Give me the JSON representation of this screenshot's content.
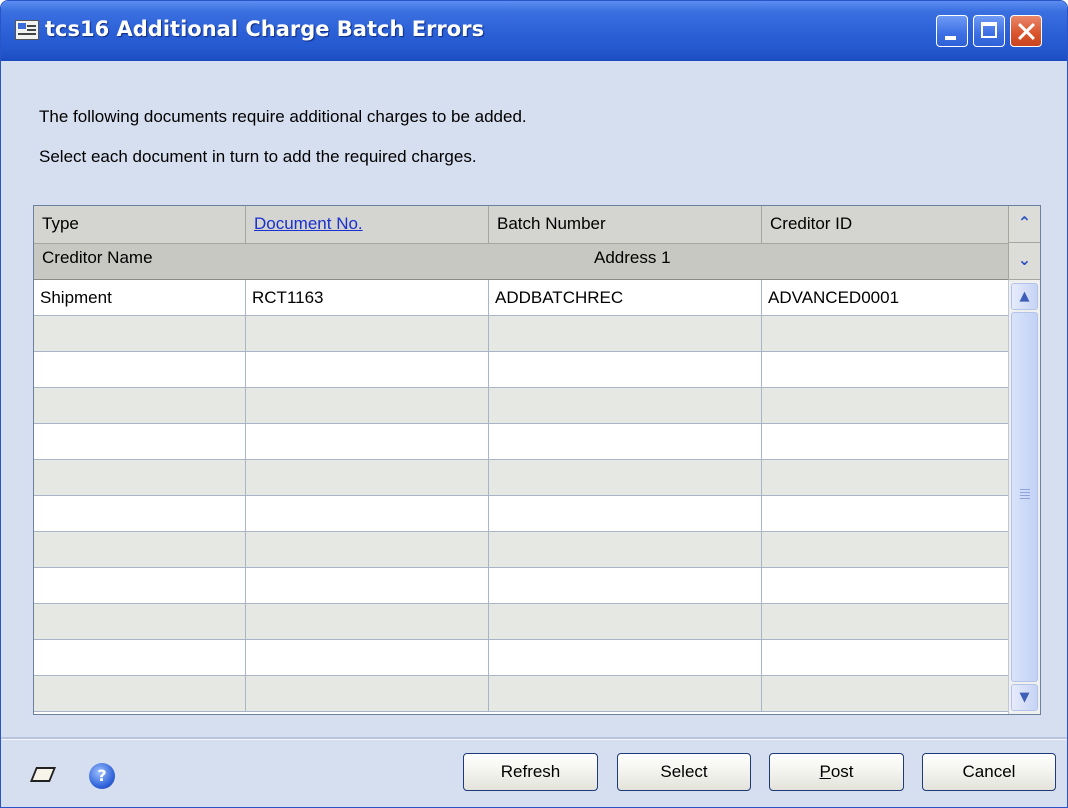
{
  "window": {
    "title": "tcs16 Additional Charge Batch Errors"
  },
  "message": {
    "line1": "The following documents require additional charges to be added.",
    "line2": "Select each document in turn to add the required charges."
  },
  "grid": {
    "columns": [
      "Type",
      "Document No.",
      "Batch Number",
      "Creditor ID"
    ],
    "columns_row2": [
      "Creditor Name",
      "Address 1"
    ],
    "rows": [
      [
        "Shipment",
        "RCT1163",
        "ADDBATCHREC",
        "ADVANCED0001"
      ],
      [
        "",
        "",
        "",
        ""
      ],
      [
        "",
        "",
        "",
        ""
      ],
      [
        "",
        "",
        "",
        ""
      ],
      [
        "",
        "",
        "",
        ""
      ],
      [
        "",
        "",
        "",
        ""
      ],
      [
        "",
        "",
        "",
        ""
      ],
      [
        "",
        "",
        "",
        ""
      ],
      [
        "",
        "",
        "",
        ""
      ],
      [
        "",
        "",
        "",
        ""
      ],
      [
        "",
        "",
        "",
        ""
      ],
      [
        "",
        "",
        "",
        ""
      ]
    ]
  },
  "buttons": {
    "refresh": "Refresh",
    "select": "Select",
    "post_accel": "P",
    "post_rest": "ost",
    "cancel": "Cancel"
  },
  "icons": {
    "help": "?"
  }
}
